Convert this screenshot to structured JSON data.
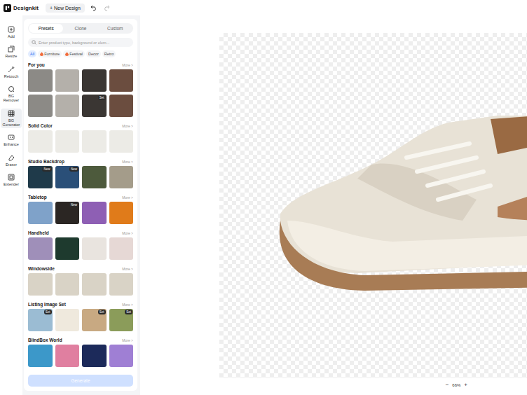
{
  "app": {
    "logo": "Designkit",
    "new_design": "+ New Design"
  },
  "history": {
    "undo_disabled": false,
    "redo_disabled": true
  },
  "rail": [
    {
      "label": "Add",
      "selected": false
    },
    {
      "label": "Resize",
      "selected": false
    },
    {
      "label": "Retouch",
      "selected": false
    },
    {
      "label": "BG Remover",
      "selected": false
    },
    {
      "label": "BG Generator",
      "selected": true
    },
    {
      "label": "Enhance",
      "selected": false
    },
    {
      "label": "Eraser",
      "selected": false
    },
    {
      "label": "Extender",
      "selected": false
    }
  ],
  "panel_tabs": [
    {
      "label": "Presets",
      "selected": true
    },
    {
      "label": "Clone",
      "selected": false
    },
    {
      "label": "Custom",
      "selected": false
    }
  ],
  "search": {
    "placeholder": "Enter product type, background or elem..."
  },
  "chips": [
    {
      "label": "All",
      "selected": true,
      "hot": false
    },
    {
      "label": "Furniture",
      "selected": false,
      "hot": true
    },
    {
      "label": "Festival",
      "selected": false,
      "hot": true
    },
    {
      "label": "Decor",
      "selected": false,
      "hot": false
    },
    {
      "label": "Retro",
      "selected": false,
      "hot": false
    }
  ],
  "sections": [
    {
      "title": "For you",
      "more": "More >",
      "items": [
        {
          "badge": ""
        },
        {
          "badge": ""
        },
        {
          "badge": ""
        },
        {
          "badge": ""
        },
        {
          "badge": ""
        },
        {
          "badge": ""
        },
        {
          "badge": "Set"
        },
        {
          "badge": ""
        }
      ]
    },
    {
      "title": "Solid Color",
      "more": "More >",
      "items": [
        {
          "badge": ""
        },
        {
          "badge": ""
        },
        {
          "badge": ""
        },
        {
          "badge": ""
        }
      ]
    },
    {
      "title": "Studio Backdrop",
      "more": "More >",
      "items": [
        {
          "badge": "New"
        },
        {
          "badge": "New"
        },
        {
          "badge": ""
        },
        {
          "badge": ""
        }
      ]
    },
    {
      "title": "Tabletop",
      "more": "More >",
      "items": [
        {
          "badge": ""
        },
        {
          "badge": "New"
        },
        {
          "badge": ""
        },
        {
          "badge": ""
        }
      ]
    },
    {
      "title": "Handheld",
      "more": "More >",
      "items": [
        {
          "badge": ""
        },
        {
          "badge": ""
        },
        {
          "badge": ""
        },
        {
          "badge": ""
        }
      ]
    },
    {
      "title": "Windowside",
      "more": "More >",
      "items": [
        {
          "badge": ""
        },
        {
          "badge": ""
        },
        {
          "badge": ""
        },
        {
          "badge": ""
        }
      ]
    },
    {
      "title": "Listing Image Set",
      "more": "More >",
      "items": [
        {
          "badge": "Set"
        },
        {
          "badge": ""
        },
        {
          "badge": "Set"
        },
        {
          "badge": "Set"
        }
      ]
    },
    {
      "title": "BlindBox World",
      "more": "More >",
      "items": [
        {
          "badge": ""
        },
        {
          "badge": ""
        },
        {
          "badge": ""
        },
        {
          "badge": ""
        }
      ]
    }
  ],
  "generate": {
    "label": "Generate",
    "disabled": true
  },
  "zoom": {
    "minus": "−",
    "value": "66%",
    "plus": "+"
  }
}
